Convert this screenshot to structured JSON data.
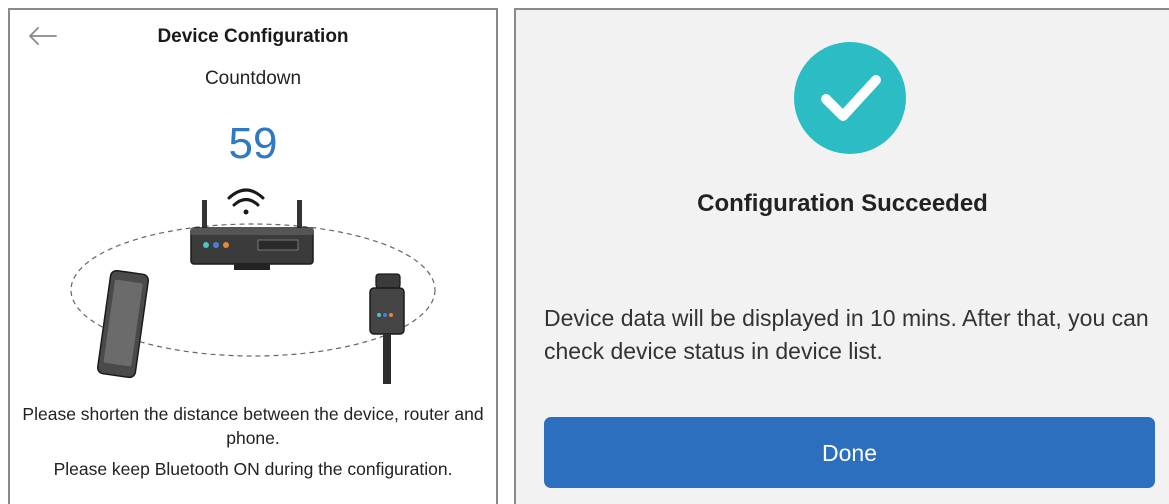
{
  "config_screen": {
    "back_icon": "arrow-left-icon",
    "title": "Device Configuration",
    "subtitle": "Countdown",
    "countdown_value": "59",
    "illustration_icons": [
      "router-icon",
      "wifi-icon",
      "phone-icon",
      "device-dongle-icon"
    ],
    "note_distance": "Please shorten the distance between the device, router and phone.",
    "note_bluetooth": "Please keep Bluetooth ON during the configuration."
  },
  "success_screen": {
    "status_icon": "checkmark-icon",
    "title": "Configuration Succeeded",
    "message": "Device data will be displayed in 10 mins. After that, you can check device status in device list.",
    "done_label": "Done"
  },
  "colors": {
    "countdown": "#2f78c4",
    "success_circle": "#2cbcc4",
    "done_button": "#2d6fbf"
  }
}
